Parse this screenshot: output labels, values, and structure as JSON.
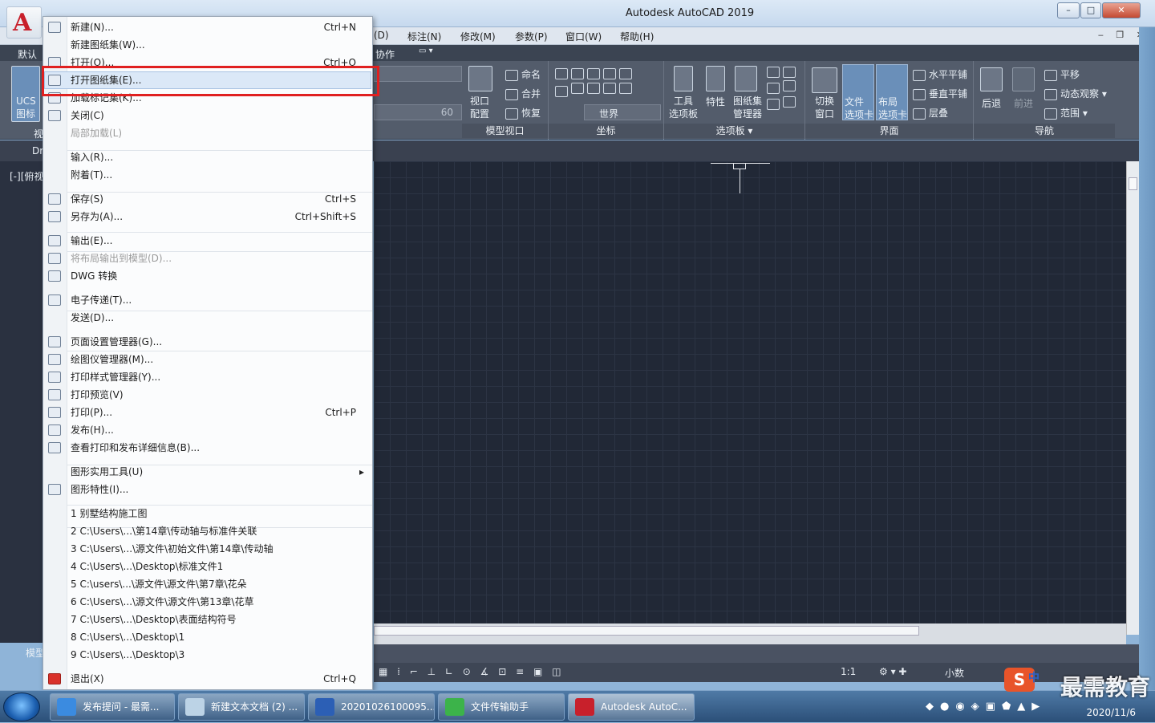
{
  "window": {
    "title": "Autodesk AutoCAD 2019",
    "min": "–",
    "max": "□",
    "close": "✕"
  },
  "menubar": [
    "(D)",
    "标注(N)",
    "修改(M)",
    "参数(P)",
    "窗口(W)",
    "帮助(H)"
  ],
  "ribbon_tabs": {
    "left_label": "默认",
    "collab": "协作"
  },
  "ribbon": {
    "ucs": "UCS\n图标",
    "viewport_panel": {
      "label": "模型视口",
      "items": [
        "视口\n配置",
        "命名",
        "合并",
        "恢复"
      ]
    },
    "coords_panel": {
      "label": "坐标",
      "world": "世界"
    },
    "palettes_panel": {
      "label": "选项板",
      "items": [
        "工具\n选项板",
        "特性",
        "图纸集\n管理器"
      ]
    },
    "interface_panel": {
      "label": "界面",
      "items": [
        "切换\n窗口",
        "文件\n选项卡",
        "布局\n选项卡",
        "水平平铺",
        "垂直平铺",
        "层叠"
      ]
    },
    "nav_panel": {
      "label": "导航",
      "items": [
        "后退",
        "前进",
        "平移",
        "动态观察",
        "范围"
      ]
    },
    "value_60": "60"
  },
  "left_side": {
    "view_label": "[-][俯视",
    "dr": "Dr",
    "model": "模型",
    "vis": "视"
  },
  "app_menu": {
    "items": [
      {
        "label": "新建(N)...",
        "shortcut": "Ctrl+N",
        "icon": "new-file-icon"
      },
      {
        "label": "新建图纸集(W)...",
        "shortcut": "",
        "icon": ""
      },
      {
        "label": "打开(O)...",
        "shortcut": "Ctrl+O",
        "icon": "open-folder-icon"
      },
      {
        "label": "打开图纸集(E)...",
        "shortcut": "",
        "icon": "open-sheetset-icon"
      },
      {
        "label": "加载标记集(K)...",
        "shortcut": "",
        "icon": "markup-icon"
      },
      {
        "label": "关闭(C)",
        "shortcut": "",
        "icon": "close-doc-icon"
      },
      {
        "label": "局部加载(L)",
        "shortcut": "",
        "icon": ""
      },
      {
        "label": "输入(R)...",
        "shortcut": "",
        "icon": ""
      },
      {
        "label": "附着(T)...",
        "shortcut": "",
        "icon": ""
      },
      {
        "label": "保存(S)",
        "shortcut": "Ctrl+S",
        "icon": "save-icon"
      },
      {
        "label": "另存为(A)...",
        "shortcut": "Ctrl+Shift+S",
        "icon": "save-as-icon"
      },
      {
        "label": "输出(E)...",
        "shortcut": "",
        "icon": "export-icon"
      },
      {
        "label": "将布局输出到模型(D)...",
        "shortcut": "",
        "icon": "layout-export-icon"
      },
      {
        "label": "DWG 转换",
        "shortcut": "",
        "icon": "dwg-convert-icon"
      },
      {
        "label": "电子传递(T)...",
        "shortcut": "",
        "icon": "etransmit-icon"
      },
      {
        "label": "发送(D)...",
        "shortcut": "",
        "icon": ""
      },
      {
        "label": "页面设置管理器(G)...",
        "shortcut": "",
        "icon": "page-setup-icon"
      },
      {
        "label": "绘图仪管理器(M)...",
        "shortcut": "",
        "icon": "plotter-icon"
      },
      {
        "label": "打印样式管理器(Y)...",
        "shortcut": "",
        "icon": "plot-style-icon"
      },
      {
        "label": "打印预览(V)",
        "shortcut": "",
        "icon": "plot-preview-icon"
      },
      {
        "label": "打印(P)...",
        "shortcut": "Ctrl+P",
        "icon": "print-icon"
      },
      {
        "label": "发布(H)...",
        "shortcut": "",
        "icon": "publish-icon"
      },
      {
        "label": "查看打印和发布详细信息(B)...",
        "shortcut": "",
        "icon": "plot-details-icon"
      },
      {
        "label": "图形实用工具(U)",
        "shortcut": "",
        "icon": ""
      },
      {
        "label": "图形特性(I)...",
        "shortcut": "",
        "icon": "drawing-props-icon"
      },
      {
        "label": "1 别墅结构施工图",
        "shortcut": "",
        "icon": ""
      },
      {
        "label": "2 C:\\Users\\...\\第14章\\传动轴与标准件关联",
        "shortcut": "",
        "icon": ""
      },
      {
        "label": "3 C:\\Users\\...\\源文件\\初始文件\\第14章\\传动轴",
        "shortcut": "",
        "icon": ""
      },
      {
        "label": "4 C:\\Users\\...\\Desktop\\标准文件1",
        "shortcut": "",
        "icon": ""
      },
      {
        "label": "5 C:\\users\\...\\源文件\\源文件\\第7章\\花朵",
        "shortcut": "",
        "icon": ""
      },
      {
        "label": "6 C:\\Users\\...\\源文件\\源文件\\第13章\\花草",
        "shortcut": "",
        "icon": ""
      },
      {
        "label": "7 C:\\Users\\...\\Desktop\\表面结构符号",
        "shortcut": "",
        "icon": ""
      },
      {
        "label": "8 C:\\Users\\...\\Desktop\\1",
        "shortcut": "",
        "icon": ""
      },
      {
        "label": "9 C:\\Users\\...\\Desktop\\3",
        "shortcut": "",
        "icon": ""
      },
      {
        "label": "退出(X)",
        "shortcut": "Ctrl+Q",
        "icon": "exit-icon"
      }
    ],
    "highlighted_index": 3
  },
  "statusbar": {
    "scale": "1:1",
    "units": "小数"
  },
  "taskbar": {
    "items": [
      "发布提问 - 最需...",
      "新建文本文档 (2) ...",
      "20201026100095...",
      "文件传输助手",
      "Autodesk AutoC..."
    ],
    "clock_date": "2020/11/6"
  },
  "watermark": {
    "text": "最需教育",
    "logo": "S",
    "tray_text": "中"
  }
}
